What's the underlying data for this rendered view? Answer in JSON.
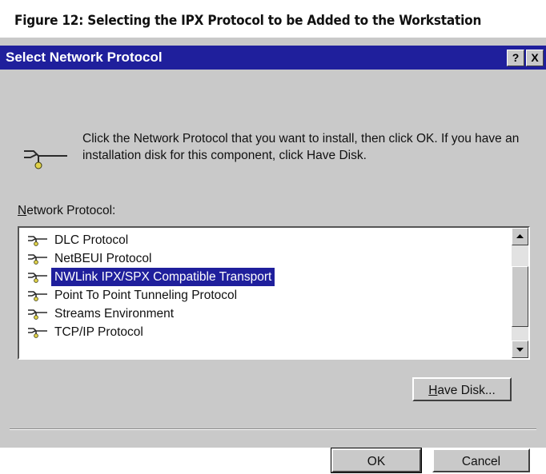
{
  "figure_caption": "Figure 12: Selecting the IPX Protocol to be Added to the Workstation",
  "dialog": {
    "title": "Select Network Protocol",
    "help_button": "?",
    "close_button": "X",
    "instruction": "Click the Network Protocol that you want to install, then click OK.  If you have an installation disk for this component, click Have Disk.",
    "list_label_first": "N",
    "list_label_rest": "etwork Protocol:",
    "protocols": [
      "DLC Protocol",
      "NetBEUI Protocol",
      "NWLink IPX/SPX Compatible Transport",
      "Point To Point Tunneling Protocol",
      "Streams Environment",
      "TCP/IP Protocol"
    ],
    "selected_protocol": "NWLink IPX/SPX Compatible Transport",
    "have_disk_first": "H",
    "have_disk_rest": "ave Disk...",
    "ok_label": "OK",
    "cancel_label": "Cancel"
  },
  "colors": {
    "titlebar": "#1f1f9c",
    "selection": "#1f1f9c",
    "dialog_face": "#c9c9c9"
  }
}
